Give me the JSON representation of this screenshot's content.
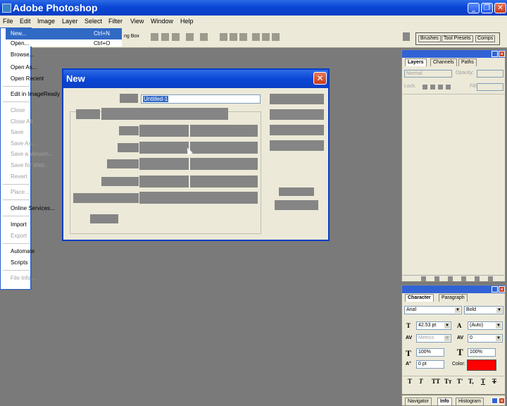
{
  "app": {
    "title": "Adobe Photoshop"
  },
  "menubar": [
    "File",
    "Edit",
    "Image",
    "Layer",
    "Select",
    "Filter",
    "View",
    "Window",
    "Help"
  ],
  "options_bar": {
    "bounding_box_label": "ng Box",
    "palette_well": [
      "Brushes",
      "Tool Presets",
      "Comps"
    ]
  },
  "file_menu": {
    "highlighted": {
      "label": "New...",
      "shortcut": "Ctrl+N"
    },
    "peek": {
      "label": "Open...",
      "shortcut": "Ctrl+O"
    },
    "items": [
      {
        "label": "Browse...",
        "disabled": false
      },
      {
        "label": "Open As...",
        "disabled": false
      },
      {
        "label": "Open Recent",
        "disabled": false
      },
      {
        "label": "Edit in ImageReady",
        "disabled": false
      },
      {
        "label": "Close",
        "disabled": true
      },
      {
        "label": "Close All",
        "disabled": true
      },
      {
        "label": "Save",
        "disabled": true
      },
      {
        "label": "Save As...",
        "disabled": true
      },
      {
        "label": "Save a Version...",
        "disabled": true
      },
      {
        "label": "Save for Web...",
        "disabled": true
      },
      {
        "label": "Revert",
        "disabled": true
      },
      {
        "label": "Place...",
        "disabled": true
      },
      {
        "label": "Online Services...",
        "disabled": false
      },
      {
        "label": "Import",
        "disabled": false
      },
      {
        "label": "Export",
        "disabled": true
      },
      {
        "label": "Automate",
        "disabled": false
      },
      {
        "label": "Scripts",
        "disabled": false
      },
      {
        "label": "File Info...",
        "disabled": true
      }
    ]
  },
  "dialog": {
    "title": "New",
    "close_glyph": "✕",
    "name_value": "Untitled-1"
  },
  "layers_panel": {
    "tabs": [
      "Layers",
      "Channels",
      "Paths"
    ],
    "blend_mode": "Normal",
    "opacity_label": "Opacity:",
    "lock_label": "Lock:",
    "fill_label": "Fill:"
  },
  "character_panel": {
    "tabs": [
      "Character",
      "Paragraph"
    ],
    "font_family": "Arial",
    "font_style": "Bold",
    "font_size": "42.53 pt",
    "leading": "(Auto)",
    "kerning": "Metrics",
    "tracking": "0",
    "vertical_scale": "100%",
    "horizontal_scale": "100%",
    "baseline_shift": "0 pt",
    "color_label": "Color:",
    "color": "#ff0000",
    "style_buttons": [
      "T",
      "T",
      "TT",
      "Tт",
      "T'",
      "T,",
      "T",
      "T"
    ]
  },
  "navigator_panel": {
    "tabs": [
      "Navigator",
      "Info",
      "Histogram"
    ]
  }
}
